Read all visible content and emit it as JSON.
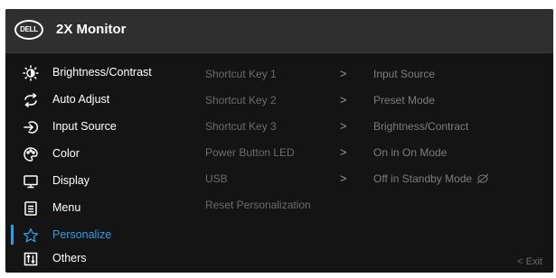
{
  "header": {
    "logo_text": "DELL",
    "model": "2X Monitor"
  },
  "menu": [
    {
      "label": "Brightness/Contrast",
      "icon": "brightness-icon"
    },
    {
      "label": "Auto Adjust",
      "icon": "auto-adjust-icon"
    },
    {
      "label": "Input Source",
      "icon": "input-source-icon"
    },
    {
      "label": "Color",
      "icon": "color-icon"
    },
    {
      "label": "Display",
      "icon": "display-icon"
    },
    {
      "label": "Menu",
      "icon": "menu-icon"
    },
    {
      "label": "Personalize",
      "icon": "star-icon",
      "selected": true
    },
    {
      "label": "Others",
      "icon": "others-icon"
    }
  ],
  "personalize": {
    "options": [
      "Shortcut Key 1",
      "Shortcut Key 2",
      "Shortcut Key 3",
      "Power Button LED",
      "USB",
      "Reset Personalization"
    ],
    "values": [
      "Input Source",
      "Preset Mode",
      "Brightness/Contract",
      "On in On Mode",
      "Off in Standby Mode"
    ],
    "chevron": ">"
  },
  "footer": {
    "exit_label": "< Exit"
  },
  "colors": {
    "accent": "#2f9ee8",
    "background": "#141414",
    "header": "#2f2f2f"
  }
}
